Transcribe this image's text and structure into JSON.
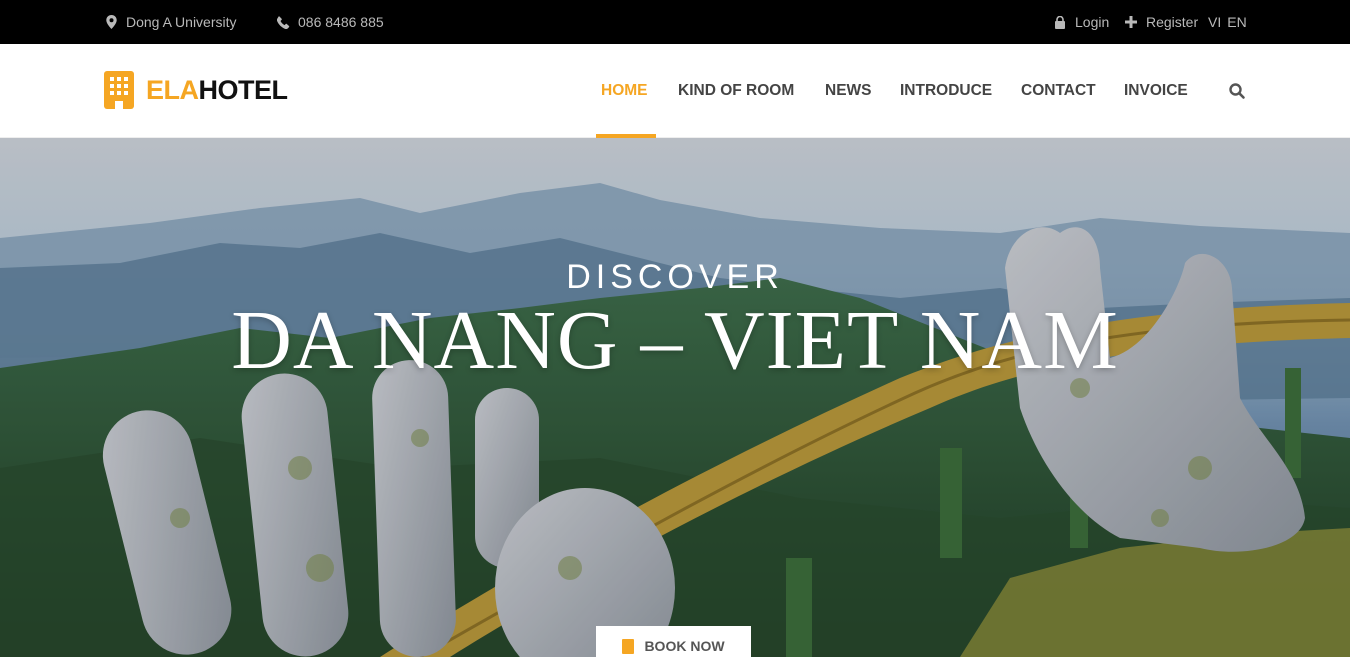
{
  "topbar": {
    "address": "Dong A University",
    "phone": "086 8486 885",
    "login": "Login",
    "register": "Register",
    "lang_vi": "VI",
    "lang_en": "EN"
  },
  "brand": {
    "part1": "ELA",
    "part2": "HOTEL"
  },
  "nav": {
    "items": [
      "HOME",
      "KIND OF ROOM",
      "NEWS",
      "INTRODUCE",
      "CONTACT",
      "INVOICE"
    ],
    "active": "HOME"
  },
  "hero": {
    "kicker": "DISCOVER",
    "headline": "DA NANG – VIET NAM",
    "cta": "BOOK NOW"
  },
  "colors": {
    "accent": "#f5a623",
    "topbar_bg": "#000000",
    "nav_text": "#444444"
  },
  "icons": {
    "address": "map-pin-icon",
    "phone": "phone-icon",
    "login": "lock-icon",
    "register": "plus-icon",
    "search": "search-icon",
    "logo": "hotel-building-icon",
    "cta": "book-icon"
  }
}
